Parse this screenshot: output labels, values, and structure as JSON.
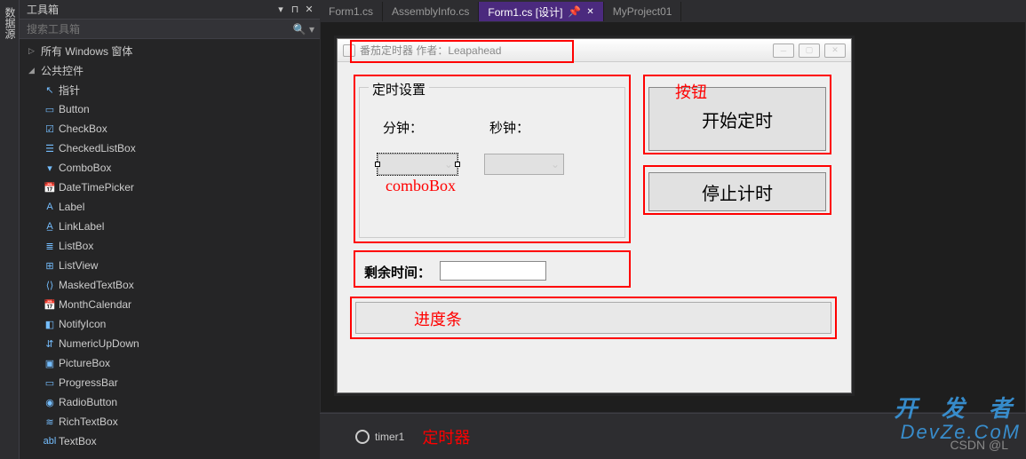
{
  "side_tab": {
    "label": "数据源"
  },
  "toolbox": {
    "title": "工具箱",
    "search_placeholder": "搜索工具箱",
    "groups": [
      {
        "label": "所有 Windows 窗体",
        "expanded": false
      },
      {
        "label": "公共控件",
        "expanded": true
      }
    ],
    "items": [
      {
        "label": "指针",
        "icon": "↖"
      },
      {
        "label": "Button",
        "icon": "▭"
      },
      {
        "label": "CheckBox",
        "icon": "☑"
      },
      {
        "label": "CheckedListBox",
        "icon": "☰"
      },
      {
        "label": "ComboBox",
        "icon": "▾"
      },
      {
        "label": "DateTimePicker",
        "icon": "📅"
      },
      {
        "label": "Label",
        "icon": "A"
      },
      {
        "label": "LinkLabel",
        "icon": "A̲"
      },
      {
        "label": "ListBox",
        "icon": "≣"
      },
      {
        "label": "ListView",
        "icon": "⊞"
      },
      {
        "label": "MaskedTextBox",
        "icon": "⟨⟩"
      },
      {
        "label": "MonthCalendar",
        "icon": "📅"
      },
      {
        "label": "NotifyIcon",
        "icon": "◧"
      },
      {
        "label": "NumericUpDown",
        "icon": "⇵"
      },
      {
        "label": "PictureBox",
        "icon": "▣"
      },
      {
        "label": "ProgressBar",
        "icon": "▭"
      },
      {
        "label": "RadioButton",
        "icon": "◉"
      },
      {
        "label": "RichTextBox",
        "icon": "≋"
      },
      {
        "label": "TextBox",
        "icon": "abl"
      }
    ]
  },
  "tabs": [
    {
      "label": "Form1.cs",
      "active": false
    },
    {
      "label": "AssemblyInfo.cs",
      "active": false
    },
    {
      "label": "Form1.cs [设计]",
      "active": true,
      "pinned": true
    },
    {
      "label": "MyProject01",
      "active": false
    }
  ],
  "form": {
    "title": "番茄定时器 作者：Leapahead",
    "groupbox_title": "定时设置",
    "label_minute": "分钟：",
    "label_second": "秒钟：",
    "btn_start": "开始定时",
    "btn_stop": "停止计时",
    "label_remain": "剩余时间："
  },
  "annotations": {
    "combobox": "comboBox",
    "button": "按钮",
    "progress": "进度条",
    "timer": "定时器"
  },
  "tray": {
    "timer_name": "timer1"
  },
  "watermark": {
    "line1": "开 发 者",
    "line2": "DevZe.CoM",
    "csdn": "CSDN @L"
  }
}
